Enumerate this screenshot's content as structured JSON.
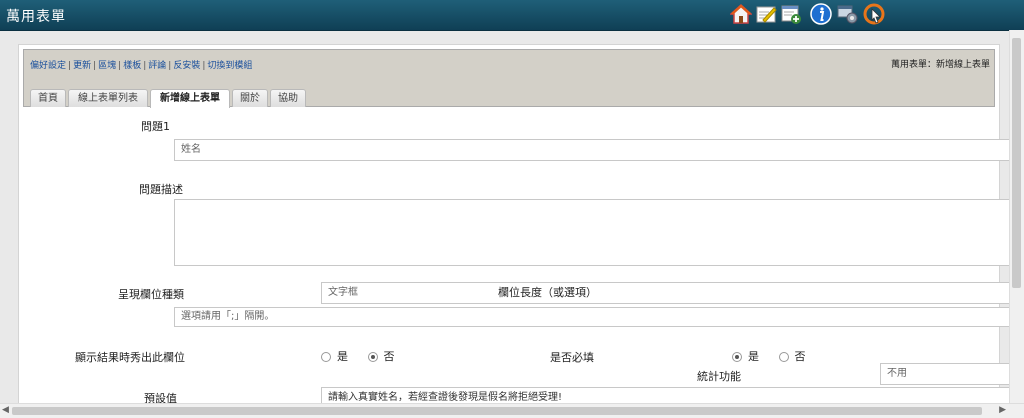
{
  "app": {
    "title": "萬用表單"
  },
  "toolbar_icons": [
    {
      "name": "home-icon",
      "color": "#e05a1a"
    },
    {
      "name": "edit-icon",
      "color": "#e8c100"
    },
    {
      "name": "form-add-icon",
      "color": "#3b8a3b"
    },
    {
      "name": "info-icon",
      "color": "#1f6fd1"
    },
    {
      "name": "settings-icon",
      "color": "#6b7f8f"
    },
    {
      "name": "logout-icon",
      "color": "#e8751a"
    }
  ],
  "header": {
    "links": [
      "偏好設定",
      "更新",
      "區塊",
      "樣板",
      "評論",
      "反安裝",
      "切換到模組"
    ],
    "breadcrumb": "萬用表單：新增線上表單"
  },
  "tabs": [
    {
      "label": "首頁",
      "active": false
    },
    {
      "label": "線上表單列表",
      "active": false
    },
    {
      "label": "新增線上表單",
      "active": true
    },
    {
      "label": "關於",
      "active": false
    },
    {
      "label": "協助",
      "active": false
    }
  ],
  "form": {
    "question_label": "問題1",
    "question_placeholder": "姓名",
    "description_label": "問題描述",
    "field_type_label": "呈現欄位種類",
    "field_type_value": "文字框",
    "field_length_label": "欄位長度（或選項）",
    "options_placeholder": "選項請用「;」隔開。",
    "show_result_label": "顯示結果時秀出此欄位",
    "show_result_options": [
      {
        "label": "是",
        "checked": false
      },
      {
        "label": "否",
        "checked": true
      }
    ],
    "required_label": "是否必填",
    "required_options": [
      {
        "label": "是",
        "checked": true
      },
      {
        "label": "否",
        "checked": false
      }
    ],
    "stats_label": "統計功能",
    "stats_value": "不用",
    "default_label": "預設值",
    "default_value": "請輸入真實姓名，若經查證後發現是假名將拒絕受理!"
  }
}
